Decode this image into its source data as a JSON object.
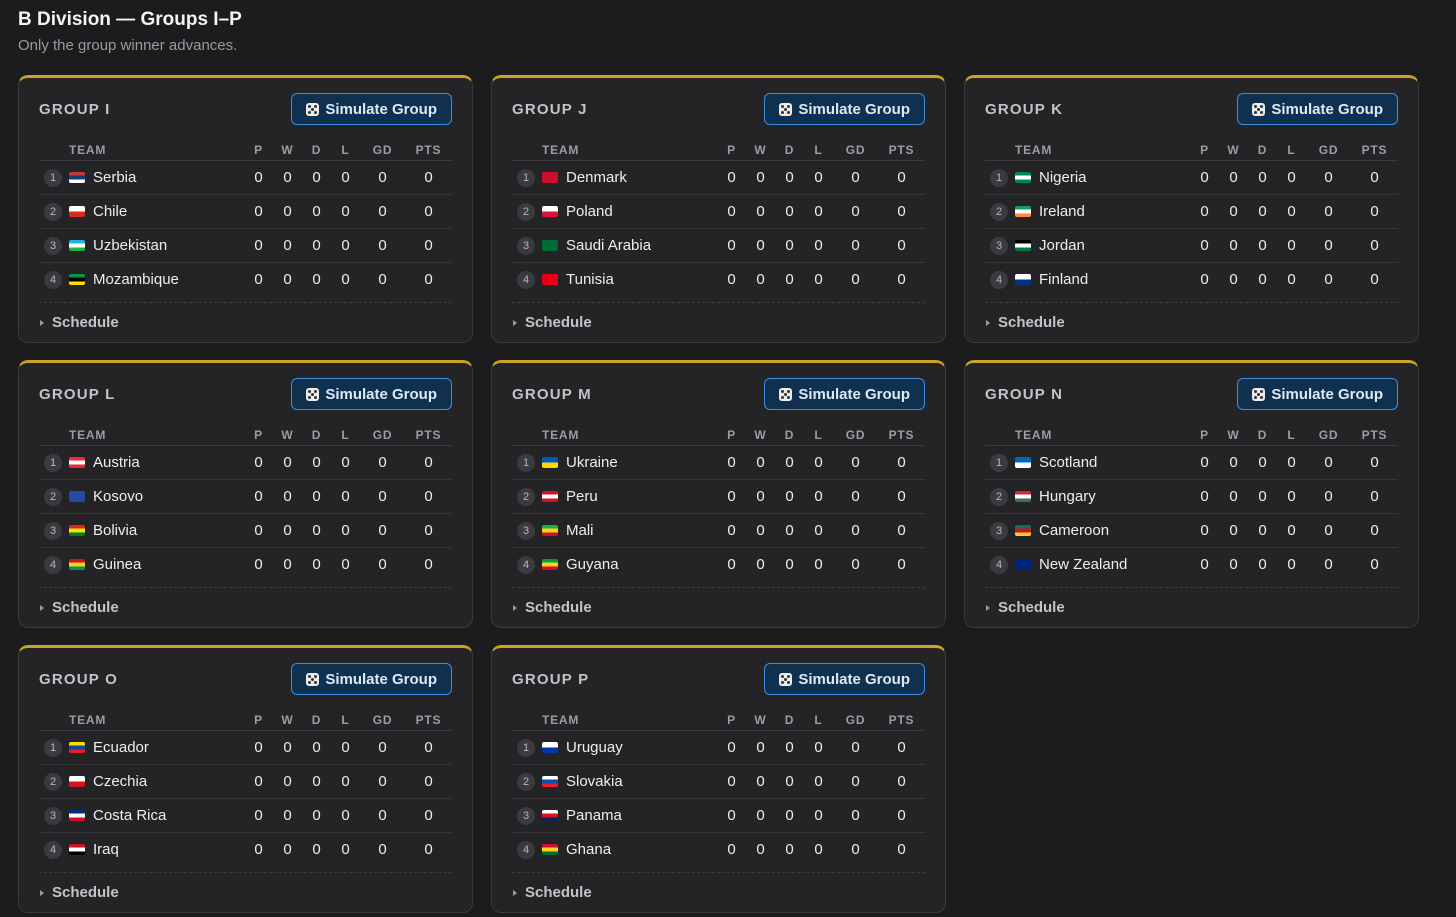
{
  "header": {
    "title": "B Division — Groups I–P",
    "subtitle": "Only the group winner advances."
  },
  "labels": {
    "simulate": "Simulate Group",
    "schedule": "Schedule",
    "columns": [
      "TEAM",
      "P",
      "W",
      "D",
      "L",
      "GD",
      "PTS"
    ]
  },
  "icons": {
    "simulate": "dice-icon",
    "schedule": "caret-right-icon"
  },
  "colors": {
    "accent_gold": "#c9a227",
    "button_border": "#3b8fe0",
    "button_bg": "#10304f",
    "background": "#1c1c1e",
    "card_bg": "#242427"
  },
  "groups": [
    {
      "name": "GROUP I",
      "teams": [
        {
          "rank": "1",
          "name": "Serbia",
          "flag": "flag-serbia-icon",
          "flag_colors": [
            "#c6363c",
            "#0c4076",
            "#ffffff"
          ],
          "p": "0",
          "w": "0",
          "d": "0",
          "l": "0",
          "gd": "0",
          "pts": "0"
        },
        {
          "rank": "2",
          "name": "Chile",
          "flag": "flag-chile-icon",
          "flag_colors": [
            "#ffffff",
            "#d52b1e"
          ],
          "p": "0",
          "w": "0",
          "d": "0",
          "l": "0",
          "gd": "0",
          "pts": "0"
        },
        {
          "rank": "3",
          "name": "Uzbekistan",
          "flag": "flag-uzbekistan-icon",
          "flag_colors": [
            "#1eb5e0",
            "#ffffff",
            "#1eb53a"
          ],
          "p": "0",
          "w": "0",
          "d": "0",
          "l": "0",
          "gd": "0",
          "pts": "0"
        },
        {
          "rank": "4",
          "name": "Mozambique",
          "flag": "flag-mozambique-icon",
          "flag_colors": [
            "#009a44",
            "#000000",
            "#fce100"
          ],
          "p": "0",
          "w": "0",
          "d": "0",
          "l": "0",
          "gd": "0",
          "pts": "0"
        }
      ]
    },
    {
      "name": "GROUP J",
      "teams": [
        {
          "rank": "1",
          "name": "Denmark",
          "flag": "flag-denmark-icon",
          "flag_colors": [
            "#c8102e",
            "#c8102e"
          ],
          "p": "0",
          "w": "0",
          "d": "0",
          "l": "0",
          "gd": "0",
          "pts": "0"
        },
        {
          "rank": "2",
          "name": "Poland",
          "flag": "flag-poland-icon",
          "flag_colors": [
            "#ffffff",
            "#dc143c"
          ],
          "p": "0",
          "w": "0",
          "d": "0",
          "l": "0",
          "gd": "0",
          "pts": "0"
        },
        {
          "rank": "3",
          "name": "Saudi Arabia",
          "flag": "flag-saudi-arabia-icon",
          "flag_colors": [
            "#006c35",
            "#006c35"
          ],
          "p": "0",
          "w": "0",
          "d": "0",
          "l": "0",
          "gd": "0",
          "pts": "0"
        },
        {
          "rank": "4",
          "name": "Tunisia",
          "flag": "flag-tunisia-icon",
          "flag_colors": [
            "#e70013",
            "#e70013"
          ],
          "p": "0",
          "w": "0",
          "d": "0",
          "l": "0",
          "gd": "0",
          "pts": "0"
        }
      ]
    },
    {
      "name": "GROUP K",
      "teams": [
        {
          "rank": "1",
          "name": "Nigeria",
          "flag": "flag-nigeria-icon",
          "flag_colors": [
            "#008751",
            "#ffffff",
            "#008751"
          ],
          "p": "0",
          "w": "0",
          "d": "0",
          "l": "0",
          "gd": "0",
          "pts": "0"
        },
        {
          "rank": "2",
          "name": "Ireland",
          "flag": "flag-ireland-icon",
          "flag_colors": [
            "#169b62",
            "#ffffff",
            "#ff883e"
          ],
          "p": "0",
          "w": "0",
          "d": "0",
          "l": "0",
          "gd": "0",
          "pts": "0"
        },
        {
          "rank": "3",
          "name": "Jordan",
          "flag": "flag-jordan-icon",
          "flag_colors": [
            "#000000",
            "#ffffff",
            "#007a3d"
          ],
          "p": "0",
          "w": "0",
          "d": "0",
          "l": "0",
          "gd": "0",
          "pts": "0"
        },
        {
          "rank": "4",
          "name": "Finland",
          "flag": "flag-finland-icon",
          "flag_colors": [
            "#ffffff",
            "#003580"
          ],
          "p": "0",
          "w": "0",
          "d": "0",
          "l": "0",
          "gd": "0",
          "pts": "0"
        }
      ]
    },
    {
      "name": "GROUP L",
      "teams": [
        {
          "rank": "1",
          "name": "Austria",
          "flag": "flag-austria-icon",
          "flag_colors": [
            "#ed2939",
            "#ffffff",
            "#ed2939"
          ],
          "p": "0",
          "w": "0",
          "d": "0",
          "l": "0",
          "gd": "0",
          "pts": "0"
        },
        {
          "rank": "2",
          "name": "Kosovo",
          "flag": "flag-kosovo-icon",
          "flag_colors": [
            "#244aa5",
            "#244aa5"
          ],
          "p": "0",
          "w": "0",
          "d": "0",
          "l": "0",
          "gd": "0",
          "pts": "0"
        },
        {
          "rank": "3",
          "name": "Bolivia",
          "flag": "flag-bolivia-icon",
          "flag_colors": [
            "#d52b1e",
            "#f9e300",
            "#007934"
          ],
          "p": "0",
          "w": "0",
          "d": "0",
          "l": "0",
          "gd": "0",
          "pts": "0"
        },
        {
          "rank": "4",
          "name": "Guinea",
          "flag": "flag-guinea-icon",
          "flag_colors": [
            "#ce1126",
            "#fcd116",
            "#009460"
          ],
          "p": "0",
          "w": "0",
          "d": "0",
          "l": "0",
          "gd": "0",
          "pts": "0"
        }
      ]
    },
    {
      "name": "GROUP M",
      "teams": [
        {
          "rank": "1",
          "name": "Ukraine",
          "flag": "flag-ukraine-icon",
          "flag_colors": [
            "#0057b7",
            "#ffd700"
          ],
          "p": "0",
          "w": "0",
          "d": "0",
          "l": "0",
          "gd": "0",
          "pts": "0"
        },
        {
          "rank": "2",
          "name": "Peru",
          "flag": "flag-peru-icon",
          "flag_colors": [
            "#d91023",
            "#ffffff",
            "#d91023"
          ],
          "p": "0",
          "w": "0",
          "d": "0",
          "l": "0",
          "gd": "0",
          "pts": "0"
        },
        {
          "rank": "3",
          "name": "Mali",
          "flag": "flag-mali-icon",
          "flag_colors": [
            "#14b53a",
            "#fcd116",
            "#ce1126"
          ],
          "p": "0",
          "w": "0",
          "d": "0",
          "l": "0",
          "gd": "0",
          "pts": "0"
        },
        {
          "rank": "4",
          "name": "Guyana",
          "flag": "flag-guyana-icon",
          "flag_colors": [
            "#009e49",
            "#fcd116",
            "#ce1126"
          ],
          "p": "0",
          "w": "0",
          "d": "0",
          "l": "0",
          "gd": "0",
          "pts": "0"
        }
      ]
    },
    {
      "name": "GROUP N",
      "teams": [
        {
          "rank": "1",
          "name": "Scotland",
          "flag": "flag-scotland-icon",
          "flag_colors": [
            "#0065bd",
            "#ffffff"
          ],
          "p": "0",
          "w": "0",
          "d": "0",
          "l": "0",
          "gd": "0",
          "pts": "0"
        },
        {
          "rank": "2",
          "name": "Hungary",
          "flag": "flag-hungary-icon",
          "flag_colors": [
            "#cd2a3e",
            "#ffffff",
            "#436f4d"
          ],
          "p": "0",
          "w": "0",
          "d": "0",
          "l": "0",
          "gd": "0",
          "pts": "0"
        },
        {
          "rank": "3",
          "name": "Cameroon",
          "flag": "flag-cameroon-icon",
          "flag_colors": [
            "#007a5e",
            "#ce1126",
            "#fcd116"
          ],
          "p": "0",
          "w": "0",
          "d": "0",
          "l": "0",
          "gd": "0",
          "pts": "0"
        },
        {
          "rank": "4",
          "name": "New Zealand",
          "flag": "flag-new-zealand-icon",
          "flag_colors": [
            "#00247d",
            "#00247d"
          ],
          "p": "0",
          "w": "0",
          "d": "0",
          "l": "0",
          "gd": "0",
          "pts": "0"
        }
      ]
    },
    {
      "name": "GROUP O",
      "teams": [
        {
          "rank": "1",
          "name": "Ecuador",
          "flag": "flag-ecuador-icon",
          "flag_colors": [
            "#ffdd00",
            "#034ea2",
            "#ed1c24"
          ],
          "p": "0",
          "w": "0",
          "d": "0",
          "l": "0",
          "gd": "0",
          "pts": "0"
        },
        {
          "rank": "2",
          "name": "Czechia",
          "flag": "flag-czechia-icon",
          "flag_colors": [
            "#ffffff",
            "#d7141a"
          ],
          "p": "0",
          "w": "0",
          "d": "0",
          "l": "0",
          "gd": "0",
          "pts": "0"
        },
        {
          "rank": "3",
          "name": "Costa Rica",
          "flag": "flag-costa-rica-icon",
          "flag_colors": [
            "#002b7f",
            "#ffffff",
            "#ce1126"
          ],
          "p": "0",
          "w": "0",
          "d": "0",
          "l": "0",
          "gd": "0",
          "pts": "0"
        },
        {
          "rank": "4",
          "name": "Iraq",
          "flag": "flag-iraq-icon",
          "flag_colors": [
            "#ce1126",
            "#ffffff",
            "#000000"
          ],
          "p": "0",
          "w": "0",
          "d": "0",
          "l": "0",
          "gd": "0",
          "pts": "0"
        }
      ]
    },
    {
      "name": "GROUP P",
      "teams": [
        {
          "rank": "1",
          "name": "Uruguay",
          "flag": "flag-uruguay-icon",
          "flag_colors": [
            "#ffffff",
            "#0038a8"
          ],
          "p": "0",
          "w": "0",
          "d": "0",
          "l": "0",
          "gd": "0",
          "pts": "0"
        },
        {
          "rank": "2",
          "name": "Slovakia",
          "flag": "flag-slovakia-icon",
          "flag_colors": [
            "#ffffff",
            "#0b4ea2",
            "#ee1c25"
          ],
          "p": "0",
          "w": "0",
          "d": "0",
          "l": "0",
          "gd": "0",
          "pts": "0"
        },
        {
          "rank": "3",
          "name": "Panama",
          "flag": "flag-panama-icon",
          "flag_colors": [
            "#ffffff",
            "#da121a",
            "#072357"
          ],
          "p": "0",
          "w": "0",
          "d": "0",
          "l": "0",
          "gd": "0",
          "pts": "0"
        },
        {
          "rank": "4",
          "name": "Ghana",
          "flag": "flag-ghana-icon",
          "flag_colors": [
            "#ce1126",
            "#fcd116",
            "#006b3f"
          ],
          "p": "0",
          "w": "0",
          "d": "0",
          "l": "0",
          "gd": "0",
          "pts": "0"
        }
      ]
    }
  ]
}
